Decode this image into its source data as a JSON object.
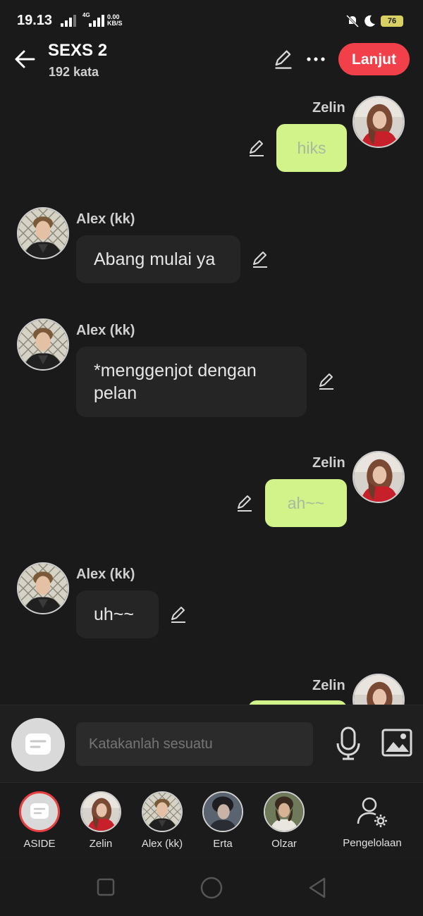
{
  "status": {
    "time": "19.13",
    "network_top": "0.00",
    "network_bottom": "KB/S",
    "gen": "4G",
    "battery": "76"
  },
  "header": {
    "title": "SEXS 2",
    "subtitle": "192 kata",
    "next_button": "Lanjut"
  },
  "messages": [
    {
      "sender": "Zelin",
      "text": "hiks",
      "side": "right"
    },
    {
      "sender": "Alex (kk)",
      "text": "Abang mulai ya",
      "side": "left"
    },
    {
      "sender": "Alex (kk)",
      "text_line1": "*menggenjot dengan",
      "text_line2": "pelan",
      "side": "left"
    },
    {
      "sender": "Zelin",
      "text": "ah~~",
      "side": "right"
    },
    {
      "sender": "Alex (kk)",
      "text": "uh~~",
      "side": "left"
    },
    {
      "sender": "Zelin",
      "text": "",
      "side": "right"
    }
  ],
  "input": {
    "placeholder": "Katakanlah sesuatu"
  },
  "characters": [
    {
      "label": "ASIDE"
    },
    {
      "label": "Zelin"
    },
    {
      "label": "Alex (kk)"
    },
    {
      "label": "Erta"
    },
    {
      "label": "Olzar"
    },
    {
      "label": "Pengelolaan"
    }
  ],
  "colors": {
    "accent": "#f2404a",
    "my_bubble": "#d2f28a",
    "other_bubble": "#252525",
    "background": "#1a1a1a"
  },
  "icons": [
    "back-arrow-icon",
    "pencil-icon",
    "more-icon",
    "microphone-icon",
    "image-icon",
    "settings-person-icon",
    "note-icon"
  ]
}
